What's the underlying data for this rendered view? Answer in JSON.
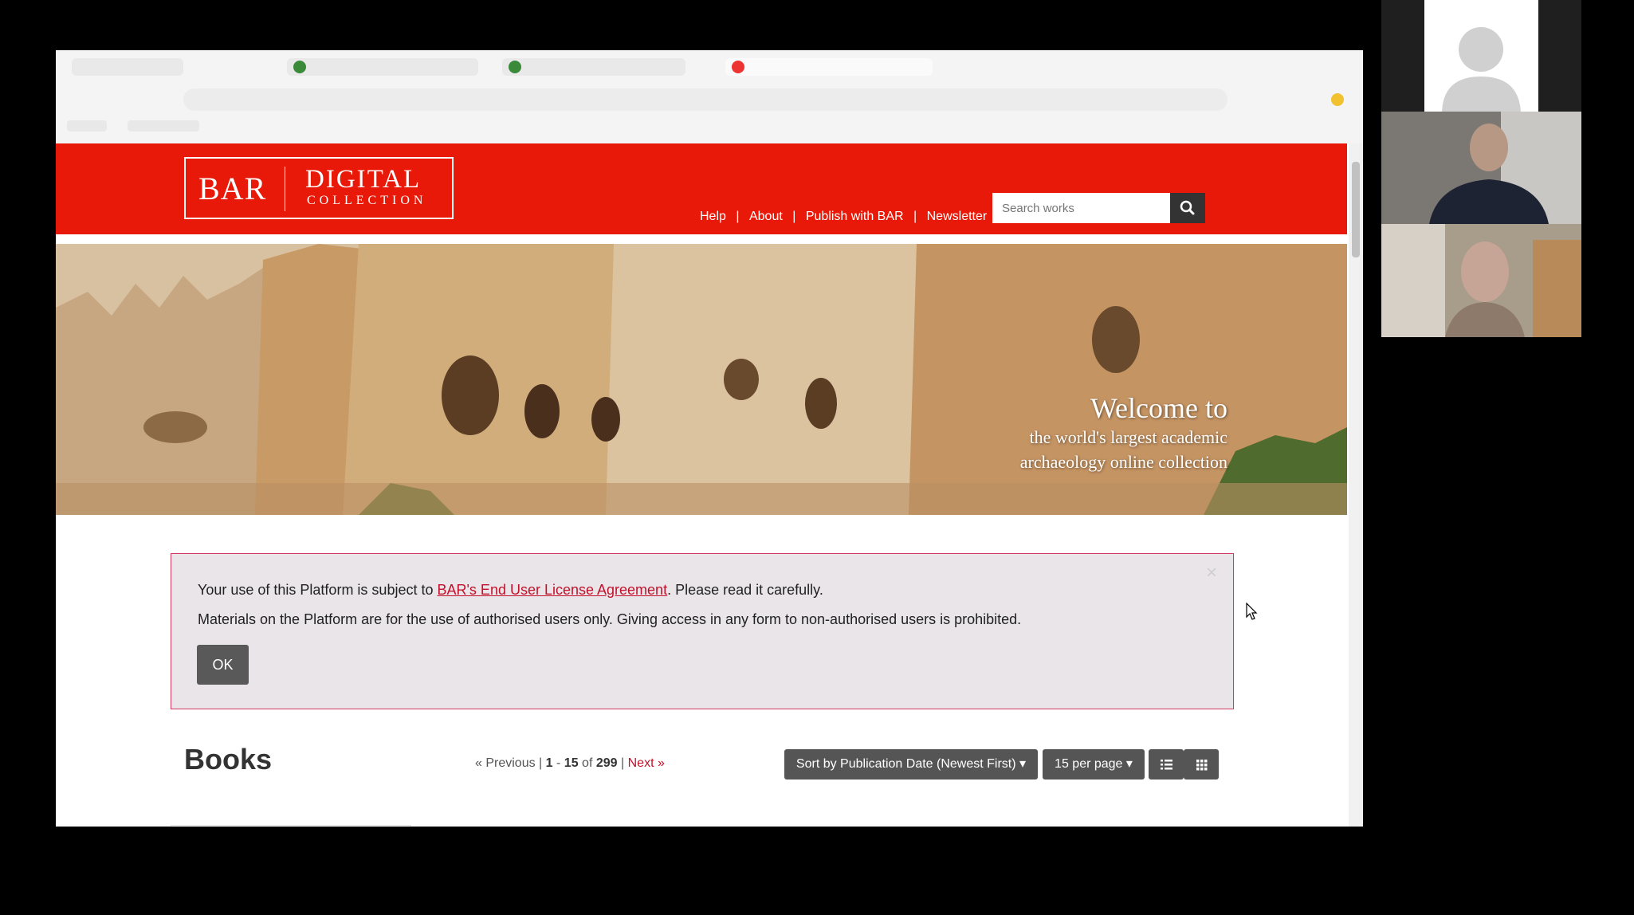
{
  "site": {
    "logo": {
      "bar": "BAR",
      "digital": "DIGITAL",
      "collection": "COLLECTION"
    },
    "nav": [
      {
        "label": "Help"
      },
      {
        "label": "About"
      },
      {
        "label": "Publish with BAR"
      },
      {
        "label": "Newsletter"
      }
    ],
    "nav_separator": "|",
    "search": {
      "placeholder": "Search works",
      "icon": "search-icon"
    },
    "hero": {
      "title": "Welcome to",
      "subtitle_line1": "the world's largest academic",
      "subtitle_line2": "archaeology online collection"
    },
    "alert": {
      "line1_prefix": "Your use of this Platform is subject to ",
      "line1_link": "BAR's End User License Agreement",
      "line1_suffix": ". Please read it carefully.",
      "line2": "Materials on the Platform are for the use of authorised users only. Giving access in any form to non-authorised users is prohibited.",
      "ok_label": "OK",
      "close_symbol": "×"
    },
    "books": {
      "title": "Books",
      "pager": {
        "previous": "« Previous",
        "sep": "|",
        "range_start": "1",
        "range_dash": "-",
        "range_end": "15",
        "of": "of",
        "total": "299",
        "next": "Next »"
      },
      "sort_label": "Sort by Publication Date (Newest First)",
      "per_page_label": "15 per page",
      "caret": "▾"
    }
  },
  "colors": {
    "header_red": "#e81909",
    "link_red": "#c3112b",
    "alert_border": "#d03a5d",
    "button_gray": "#555555"
  }
}
